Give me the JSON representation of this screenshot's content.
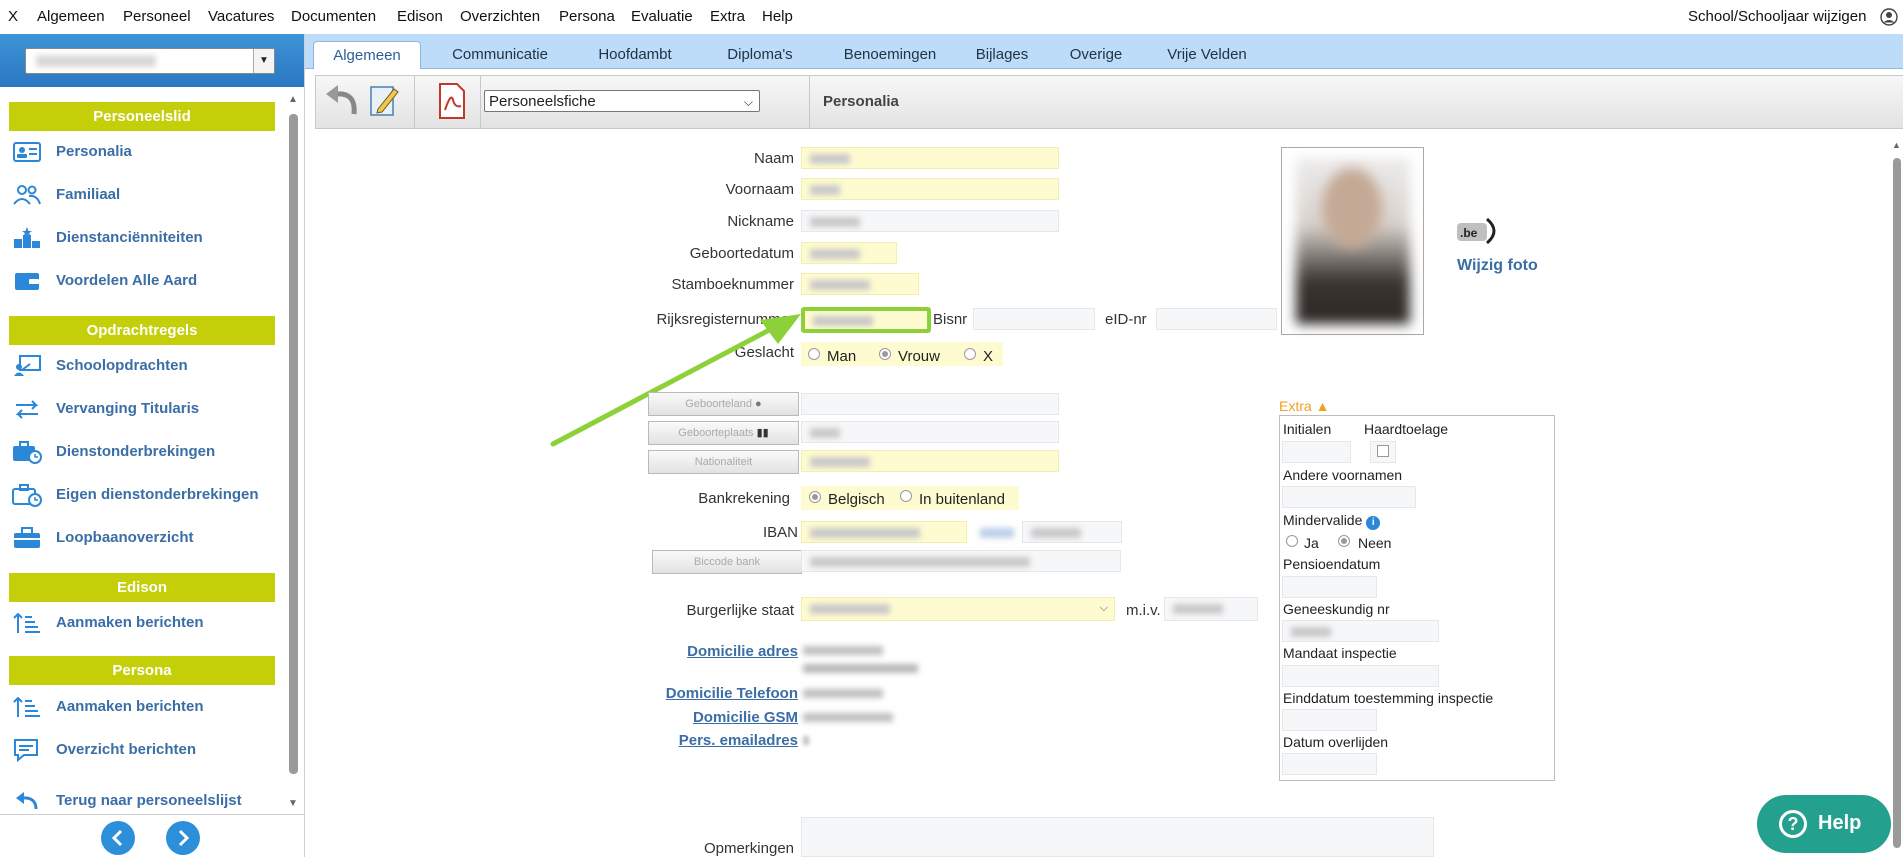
{
  "menu": {
    "close": "X",
    "items": [
      "Algemeen",
      "Personeel",
      "Vacatures",
      "Documenten",
      "Edison",
      "Overzichten",
      "Persona",
      "Evaluatie",
      "Extra",
      "Help"
    ],
    "right": "School/Schooljaar wijzigen"
  },
  "sidebar": {
    "sections": [
      {
        "title": "Personeelslid",
        "items": [
          "Personalia",
          "Familiaal",
          "Dienstanciënniteiten",
          "Voordelen Alle Aard"
        ]
      },
      {
        "title": "Opdrachtregels",
        "items": [
          "Schoolopdrachten",
          "Vervanging Titularis",
          "Dienstonderbrekingen",
          "Eigen dienstonderbrekingen",
          "Loopbaanoverzicht"
        ]
      },
      {
        "title": "Edison",
        "items": [
          "Aanmaken berichten"
        ]
      },
      {
        "title": "Persona",
        "items": [
          "Aanmaken berichten",
          "Overzicht berichten"
        ]
      }
    ],
    "back_link": "Terug naar personeelslijst"
  },
  "tabs": [
    "Algemeen",
    "Communicatie",
    "Hoofdambt",
    "Diploma's",
    "Benoemingen",
    "Bijlages",
    "Overige",
    "Vrije Velden"
  ],
  "active_tab": "Algemeen",
  "toolbar": {
    "select_value": "Personeelsfiche",
    "title": "Personalia"
  },
  "form": {
    "naam": "Naam",
    "voornaam": "Voornaam",
    "nickname": "Nickname",
    "geboortedatum": "Geboortedatum",
    "stamboeknummer": "Stamboeknummer",
    "rijksregisternummer": "Rijksregisternummer",
    "bisnr": "Bisnr",
    "eid": "eID-nr",
    "geslacht": "Geslacht",
    "gender_options": [
      "Man",
      "Vrouw",
      "X"
    ],
    "geboorteland_btn": "Geboorteland",
    "geboorteplaats_btn": "Geboorteplaats",
    "nationaliteit_btn": "Nationaliteit",
    "bankrekening": "Bankrekening",
    "bank_options": [
      "Belgisch",
      "In buitenland"
    ],
    "iban": "IBAN",
    "biccode_btn": "Biccode bank",
    "burgerlijke_staat": "Burgerlijke staat",
    "miv": "m.i.v.",
    "domicilie_adres": "Domicilie adres",
    "domicilie_telefoon": "Domicilie Telefoon",
    "domicilie_gsm": "Domicilie GSM",
    "pers_email": "Pers. emailadres",
    "opmerkingen": "Opmerkingen",
    "wijzig_foto": "Wijzig foto",
    "beid": ".be"
  },
  "extra": {
    "title": "Extra",
    "initialen": "Initialen",
    "haardtoelage": "Haardtoelage",
    "andere_voornamen": "Andere voornamen",
    "mindervalide": "Mindervalide",
    "mindervalide_options": [
      "Ja",
      "Neen"
    ],
    "pensioendatum": "Pensioendatum",
    "geneeskundig": "Geneeskundig nr",
    "mandaat": "Mandaat inspectie",
    "einddatum": "Einddatum toestemming inspectie",
    "overlijden": "Datum overlijden"
  },
  "help_label": "Help",
  "colors": {
    "accent": "#c4cf0a",
    "link": "#3a6ea5",
    "highlight": "#8dd13a",
    "help": "#24a08f"
  }
}
